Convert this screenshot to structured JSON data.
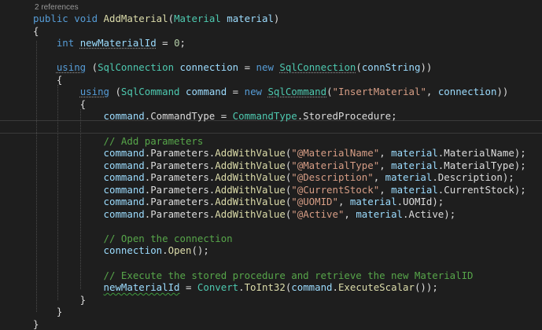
{
  "editor": {
    "codelens": "2 references",
    "lines": [
      {
        "tokens": [
          {
            "t": "public",
            "c": "keyword"
          },
          {
            "t": " ",
            "c": "plain"
          },
          {
            "t": "void",
            "c": "keyword"
          },
          {
            "t": " ",
            "c": "plain"
          },
          {
            "t": "AddMaterial",
            "c": "method"
          },
          {
            "t": "(",
            "c": "plain"
          },
          {
            "t": "Material",
            "c": "type"
          },
          {
            "t": " ",
            "c": "plain"
          },
          {
            "t": "material",
            "c": "ident"
          },
          {
            "t": ")",
            "c": "plain"
          }
        ]
      },
      {
        "tokens": [
          {
            "t": "{",
            "c": "plain"
          }
        ]
      },
      {
        "tokens": [
          {
            "t": "    ",
            "c": "plain"
          },
          {
            "t": "int",
            "c": "keyword"
          },
          {
            "t": " ",
            "c": "plain"
          },
          {
            "t": "newMaterialId",
            "c": "ident",
            "u": "dots"
          },
          {
            "t": " = ",
            "c": "plain"
          },
          {
            "t": "0",
            "c": "number"
          },
          {
            "t": ";",
            "c": "plain"
          }
        ]
      },
      {
        "tokens": []
      },
      {
        "tokens": [
          {
            "t": "    ",
            "c": "plain"
          },
          {
            "t": "using",
            "c": "keyword",
            "u": "dots"
          },
          {
            "t": " (",
            "c": "plain"
          },
          {
            "t": "SqlConnection",
            "c": "type"
          },
          {
            "t": " ",
            "c": "plain"
          },
          {
            "t": "connection",
            "c": "ident"
          },
          {
            "t": " = ",
            "c": "plain"
          },
          {
            "t": "new",
            "c": "keyword"
          },
          {
            "t": " ",
            "c": "plain"
          },
          {
            "t": "SqlConnection",
            "c": "type",
            "u": "dots"
          },
          {
            "t": "(",
            "c": "plain"
          },
          {
            "t": "connString",
            "c": "ident"
          },
          {
            "t": "))",
            "c": "plain"
          }
        ]
      },
      {
        "tokens": [
          {
            "t": "    {",
            "c": "plain"
          }
        ]
      },
      {
        "tokens": [
          {
            "t": "        ",
            "c": "plain"
          },
          {
            "t": "using",
            "c": "keyword",
            "u": "dots"
          },
          {
            "t": " (",
            "c": "plain"
          },
          {
            "t": "SqlCommand",
            "c": "type"
          },
          {
            "t": " ",
            "c": "plain"
          },
          {
            "t": "command",
            "c": "ident"
          },
          {
            "t": " = ",
            "c": "plain"
          },
          {
            "t": "new",
            "c": "keyword"
          },
          {
            "t": " ",
            "c": "plain"
          },
          {
            "t": "SqlCommand",
            "c": "type",
            "u": "dots"
          },
          {
            "t": "(",
            "c": "plain"
          },
          {
            "t": "\"InsertMaterial\"",
            "c": "string"
          },
          {
            "t": ", ",
            "c": "plain"
          },
          {
            "t": "connection",
            "c": "ident"
          },
          {
            "t": "))",
            "c": "plain"
          }
        ]
      },
      {
        "tokens": [
          {
            "t": "        {",
            "c": "plain"
          }
        ]
      },
      {
        "tokens": [
          {
            "t": "            ",
            "c": "plain"
          },
          {
            "t": "command",
            "c": "ident"
          },
          {
            "t": ".CommandType = ",
            "c": "plain"
          },
          {
            "t": "CommandType",
            "c": "type"
          },
          {
            "t": ".StoredProcedure;",
            "c": "plain"
          }
        ]
      },
      {
        "tokens": []
      },
      {
        "tokens": [
          {
            "t": "            ",
            "c": "plain"
          },
          {
            "t": "// Add parameters",
            "c": "comment"
          }
        ]
      },
      {
        "tokens": [
          {
            "t": "            ",
            "c": "plain"
          },
          {
            "t": "command",
            "c": "ident"
          },
          {
            "t": ".Parameters.",
            "c": "plain"
          },
          {
            "t": "AddWithValue",
            "c": "method"
          },
          {
            "t": "(",
            "c": "plain"
          },
          {
            "t": "\"@MaterialName\"",
            "c": "string"
          },
          {
            "t": ", ",
            "c": "plain"
          },
          {
            "t": "material",
            "c": "ident"
          },
          {
            "t": ".MaterialName);",
            "c": "plain"
          }
        ]
      },
      {
        "tokens": [
          {
            "t": "            ",
            "c": "plain"
          },
          {
            "t": "command",
            "c": "ident"
          },
          {
            "t": ".Parameters.",
            "c": "plain"
          },
          {
            "t": "AddWithValue",
            "c": "method"
          },
          {
            "t": "(",
            "c": "plain"
          },
          {
            "t": "\"@MaterialType\"",
            "c": "string"
          },
          {
            "t": ", ",
            "c": "plain"
          },
          {
            "t": "material",
            "c": "ident"
          },
          {
            "t": ".MaterialType);",
            "c": "plain"
          }
        ]
      },
      {
        "tokens": [
          {
            "t": "            ",
            "c": "plain"
          },
          {
            "t": "command",
            "c": "ident"
          },
          {
            "t": ".Parameters.",
            "c": "plain"
          },
          {
            "t": "AddWithValue",
            "c": "method"
          },
          {
            "t": "(",
            "c": "plain"
          },
          {
            "t": "\"@Description\"",
            "c": "string"
          },
          {
            "t": ", ",
            "c": "plain"
          },
          {
            "t": "material",
            "c": "ident"
          },
          {
            "t": ".Description);",
            "c": "plain"
          }
        ]
      },
      {
        "tokens": [
          {
            "t": "            ",
            "c": "plain"
          },
          {
            "t": "command",
            "c": "ident"
          },
          {
            "t": ".Parameters.",
            "c": "plain"
          },
          {
            "t": "AddWithValue",
            "c": "method"
          },
          {
            "t": "(",
            "c": "plain"
          },
          {
            "t": "\"@CurrentStock\"",
            "c": "string"
          },
          {
            "t": ", ",
            "c": "plain"
          },
          {
            "t": "material",
            "c": "ident"
          },
          {
            "t": ".CurrentStock);",
            "c": "plain"
          }
        ]
      },
      {
        "tokens": [
          {
            "t": "            ",
            "c": "plain"
          },
          {
            "t": "command",
            "c": "ident"
          },
          {
            "t": ".Parameters.",
            "c": "plain"
          },
          {
            "t": "AddWithValue",
            "c": "method"
          },
          {
            "t": "(",
            "c": "plain"
          },
          {
            "t": "\"@UOMID\"",
            "c": "string"
          },
          {
            "t": ", ",
            "c": "plain"
          },
          {
            "t": "material",
            "c": "ident"
          },
          {
            "t": ".UOMId);",
            "c": "plain"
          }
        ]
      },
      {
        "tokens": [
          {
            "t": "            ",
            "c": "plain"
          },
          {
            "t": "command",
            "c": "ident"
          },
          {
            "t": ".Parameters.",
            "c": "plain"
          },
          {
            "t": "AddWithValue",
            "c": "method"
          },
          {
            "t": "(",
            "c": "plain"
          },
          {
            "t": "\"@Active\"",
            "c": "string"
          },
          {
            "t": ", ",
            "c": "plain"
          },
          {
            "t": "material",
            "c": "ident"
          },
          {
            "t": ".Active);",
            "c": "plain"
          }
        ]
      },
      {
        "tokens": []
      },
      {
        "tokens": [
          {
            "t": "            ",
            "c": "plain"
          },
          {
            "t": "// Open the connection",
            "c": "comment"
          }
        ]
      },
      {
        "tokens": [
          {
            "t": "            ",
            "c": "plain"
          },
          {
            "t": "connection",
            "c": "ident"
          },
          {
            "t": ".",
            "c": "plain"
          },
          {
            "t": "Open",
            "c": "method"
          },
          {
            "t": "();",
            "c": "plain"
          }
        ]
      },
      {
        "tokens": []
      },
      {
        "tokens": [
          {
            "t": "            ",
            "c": "plain"
          },
          {
            "t": "// Execute the stored procedure and retrieve the new MaterialID",
            "c": "comment"
          }
        ]
      },
      {
        "tokens": [
          {
            "t": "            ",
            "c": "plain"
          },
          {
            "t": "newMaterialId",
            "c": "ident",
            "u": "wavy"
          },
          {
            "t": " = ",
            "c": "plain"
          },
          {
            "t": "Convert",
            "c": "type"
          },
          {
            "t": ".",
            "c": "plain"
          },
          {
            "t": "ToInt32",
            "c": "method"
          },
          {
            "t": "(",
            "c": "plain"
          },
          {
            "t": "command",
            "c": "ident"
          },
          {
            "t": ".",
            "c": "plain"
          },
          {
            "t": "ExecuteScalar",
            "c": "method"
          },
          {
            "t": "());",
            "c": "plain"
          }
        ]
      },
      {
        "tokens": [
          {
            "t": "        }",
            "c": "plain"
          }
        ]
      },
      {
        "tokens": [
          {
            "t": "    }",
            "c": "plain"
          }
        ]
      },
      {
        "tokens": [
          {
            "t": "}",
            "c": "plain"
          }
        ]
      }
    ]
  },
  "theme": {
    "background": "#1e1e1e",
    "keyword": "#569cd6",
    "type": "#4ec9b0",
    "method": "#dcdcaa",
    "string": "#d69d85",
    "comment": "#57a64a",
    "identifier": "#9cdcfe"
  }
}
